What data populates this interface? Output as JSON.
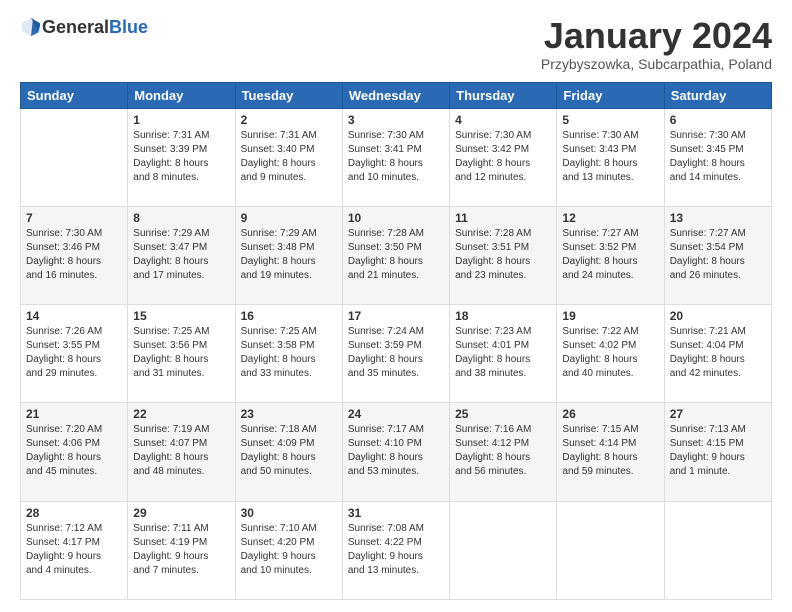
{
  "header": {
    "logo_general": "General",
    "logo_blue": "Blue",
    "month_title": "January 2024",
    "subtitle": "Przybyszowka, Subcarpathia, Poland"
  },
  "days_of_week": [
    "Sunday",
    "Monday",
    "Tuesday",
    "Wednesday",
    "Thursday",
    "Friday",
    "Saturday"
  ],
  "weeks": [
    [
      {
        "day": "",
        "info": ""
      },
      {
        "day": "1",
        "info": "Sunrise: 7:31 AM\nSunset: 3:39 PM\nDaylight: 8 hours\nand 8 minutes."
      },
      {
        "day": "2",
        "info": "Sunrise: 7:31 AM\nSunset: 3:40 PM\nDaylight: 8 hours\nand 9 minutes."
      },
      {
        "day": "3",
        "info": "Sunrise: 7:30 AM\nSunset: 3:41 PM\nDaylight: 8 hours\nand 10 minutes."
      },
      {
        "day": "4",
        "info": "Sunrise: 7:30 AM\nSunset: 3:42 PM\nDaylight: 8 hours\nand 12 minutes."
      },
      {
        "day": "5",
        "info": "Sunrise: 7:30 AM\nSunset: 3:43 PM\nDaylight: 8 hours\nand 13 minutes."
      },
      {
        "day": "6",
        "info": "Sunrise: 7:30 AM\nSunset: 3:45 PM\nDaylight: 8 hours\nand 14 minutes."
      }
    ],
    [
      {
        "day": "7",
        "info": "Sunrise: 7:30 AM\nSunset: 3:46 PM\nDaylight: 8 hours\nand 16 minutes."
      },
      {
        "day": "8",
        "info": "Sunrise: 7:29 AM\nSunset: 3:47 PM\nDaylight: 8 hours\nand 17 minutes."
      },
      {
        "day": "9",
        "info": "Sunrise: 7:29 AM\nSunset: 3:48 PM\nDaylight: 8 hours\nand 19 minutes."
      },
      {
        "day": "10",
        "info": "Sunrise: 7:28 AM\nSunset: 3:50 PM\nDaylight: 8 hours\nand 21 minutes."
      },
      {
        "day": "11",
        "info": "Sunrise: 7:28 AM\nSunset: 3:51 PM\nDaylight: 8 hours\nand 23 minutes."
      },
      {
        "day": "12",
        "info": "Sunrise: 7:27 AM\nSunset: 3:52 PM\nDaylight: 8 hours\nand 24 minutes."
      },
      {
        "day": "13",
        "info": "Sunrise: 7:27 AM\nSunset: 3:54 PM\nDaylight: 8 hours\nand 26 minutes."
      }
    ],
    [
      {
        "day": "14",
        "info": "Sunrise: 7:26 AM\nSunset: 3:55 PM\nDaylight: 8 hours\nand 29 minutes."
      },
      {
        "day": "15",
        "info": "Sunrise: 7:25 AM\nSunset: 3:56 PM\nDaylight: 8 hours\nand 31 minutes."
      },
      {
        "day": "16",
        "info": "Sunrise: 7:25 AM\nSunset: 3:58 PM\nDaylight: 8 hours\nand 33 minutes."
      },
      {
        "day": "17",
        "info": "Sunrise: 7:24 AM\nSunset: 3:59 PM\nDaylight: 8 hours\nand 35 minutes."
      },
      {
        "day": "18",
        "info": "Sunrise: 7:23 AM\nSunset: 4:01 PM\nDaylight: 8 hours\nand 38 minutes."
      },
      {
        "day": "19",
        "info": "Sunrise: 7:22 AM\nSunset: 4:02 PM\nDaylight: 8 hours\nand 40 minutes."
      },
      {
        "day": "20",
        "info": "Sunrise: 7:21 AM\nSunset: 4:04 PM\nDaylight: 8 hours\nand 42 minutes."
      }
    ],
    [
      {
        "day": "21",
        "info": "Sunrise: 7:20 AM\nSunset: 4:06 PM\nDaylight: 8 hours\nand 45 minutes."
      },
      {
        "day": "22",
        "info": "Sunrise: 7:19 AM\nSunset: 4:07 PM\nDaylight: 8 hours\nand 48 minutes."
      },
      {
        "day": "23",
        "info": "Sunrise: 7:18 AM\nSunset: 4:09 PM\nDaylight: 8 hours\nand 50 minutes."
      },
      {
        "day": "24",
        "info": "Sunrise: 7:17 AM\nSunset: 4:10 PM\nDaylight: 8 hours\nand 53 minutes."
      },
      {
        "day": "25",
        "info": "Sunrise: 7:16 AM\nSunset: 4:12 PM\nDaylight: 8 hours\nand 56 minutes."
      },
      {
        "day": "26",
        "info": "Sunrise: 7:15 AM\nSunset: 4:14 PM\nDaylight: 8 hours\nand 59 minutes."
      },
      {
        "day": "27",
        "info": "Sunrise: 7:13 AM\nSunset: 4:15 PM\nDaylight: 9 hours\nand 1 minute."
      }
    ],
    [
      {
        "day": "28",
        "info": "Sunrise: 7:12 AM\nSunset: 4:17 PM\nDaylight: 9 hours\nand 4 minutes."
      },
      {
        "day": "29",
        "info": "Sunrise: 7:11 AM\nSunset: 4:19 PM\nDaylight: 9 hours\nand 7 minutes."
      },
      {
        "day": "30",
        "info": "Sunrise: 7:10 AM\nSunset: 4:20 PM\nDaylight: 9 hours\nand 10 minutes."
      },
      {
        "day": "31",
        "info": "Sunrise: 7:08 AM\nSunset: 4:22 PM\nDaylight: 9 hours\nand 13 minutes."
      },
      {
        "day": "",
        "info": ""
      },
      {
        "day": "",
        "info": ""
      },
      {
        "day": "",
        "info": ""
      }
    ]
  ]
}
